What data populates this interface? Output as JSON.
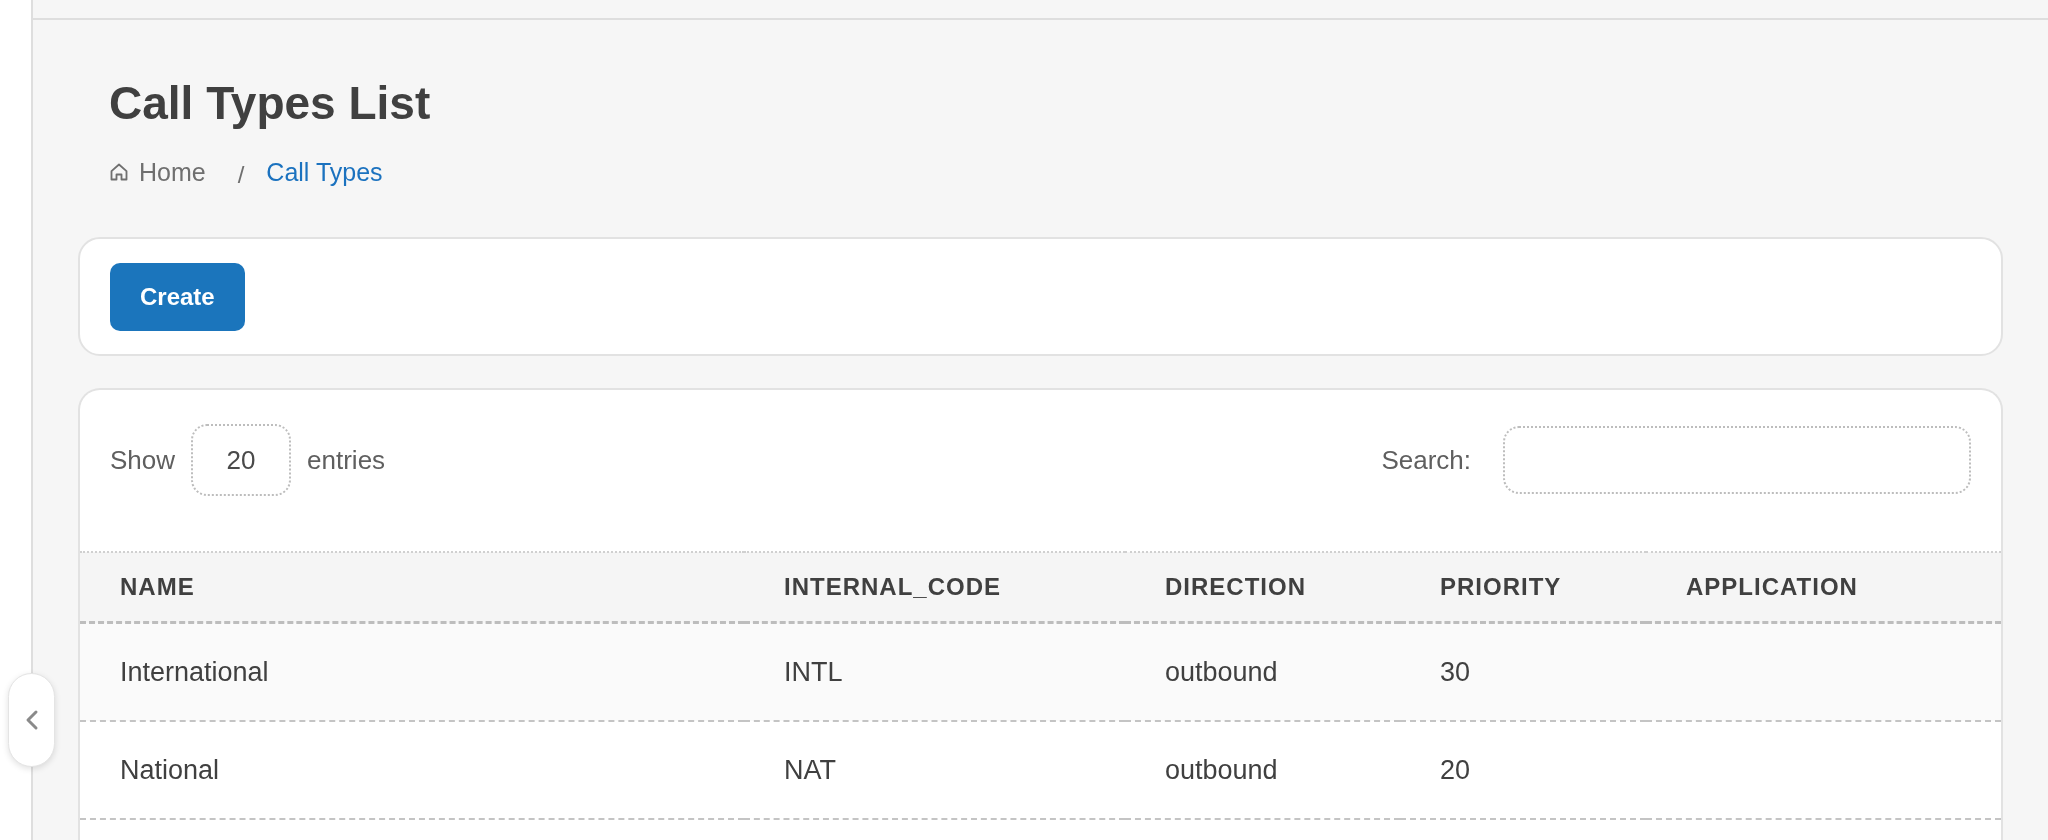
{
  "page_title": "Call Types List",
  "breadcrumb_separator": "/",
  "breadcrumb": [
    {
      "label": "Home",
      "kind": "home",
      "current": false
    },
    {
      "label": "Call Types",
      "kind": "link",
      "current": true
    }
  ],
  "toolbar": {
    "create_button": "Create"
  },
  "table_controls": {
    "show_label": "Show",
    "page_size": "20",
    "entries_label": "entries",
    "search_label": "Search:"
  },
  "table": {
    "columns": [
      "NAME",
      "INTERNAL_CODE",
      "DIRECTION",
      "PRIORITY",
      "APPLICATION"
    ],
    "rows": [
      {
        "cells": [
          "International",
          "INTL",
          "outbound",
          "30",
          ""
        ]
      },
      {
        "cells": [
          "National",
          "NAT",
          "outbound",
          "20",
          ""
        ]
      }
    ]
  }
}
